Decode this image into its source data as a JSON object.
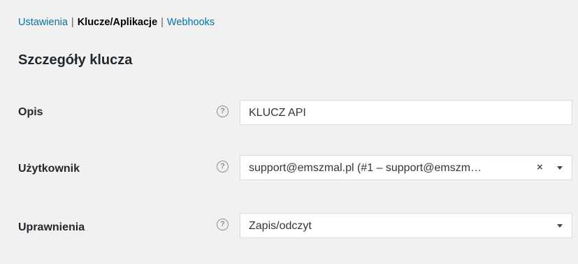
{
  "subnav": {
    "settings_label": "Ustawienia",
    "separator_1": "|",
    "keys_label": "Klucze/Aplikacje",
    "separator_2": "|",
    "webhooks_label": "Webhooks"
  },
  "section": {
    "title": "Szczegóły klucza"
  },
  "form": {
    "description": {
      "label": "Opis",
      "value": "KLUCZ API",
      "help_glyph": "?"
    },
    "user": {
      "label": "Użytkownik",
      "value": "support@emszmal.pl (#1 – support@emszm…",
      "clear_glyph": "×",
      "help_glyph": "?"
    },
    "permissions": {
      "label": "Uprawnienia",
      "value": "Zapis/odczyt",
      "help_glyph": "?"
    }
  },
  "colors": {
    "link": "#0073aa",
    "background": "#f1f1f1",
    "text": "#23282d"
  }
}
